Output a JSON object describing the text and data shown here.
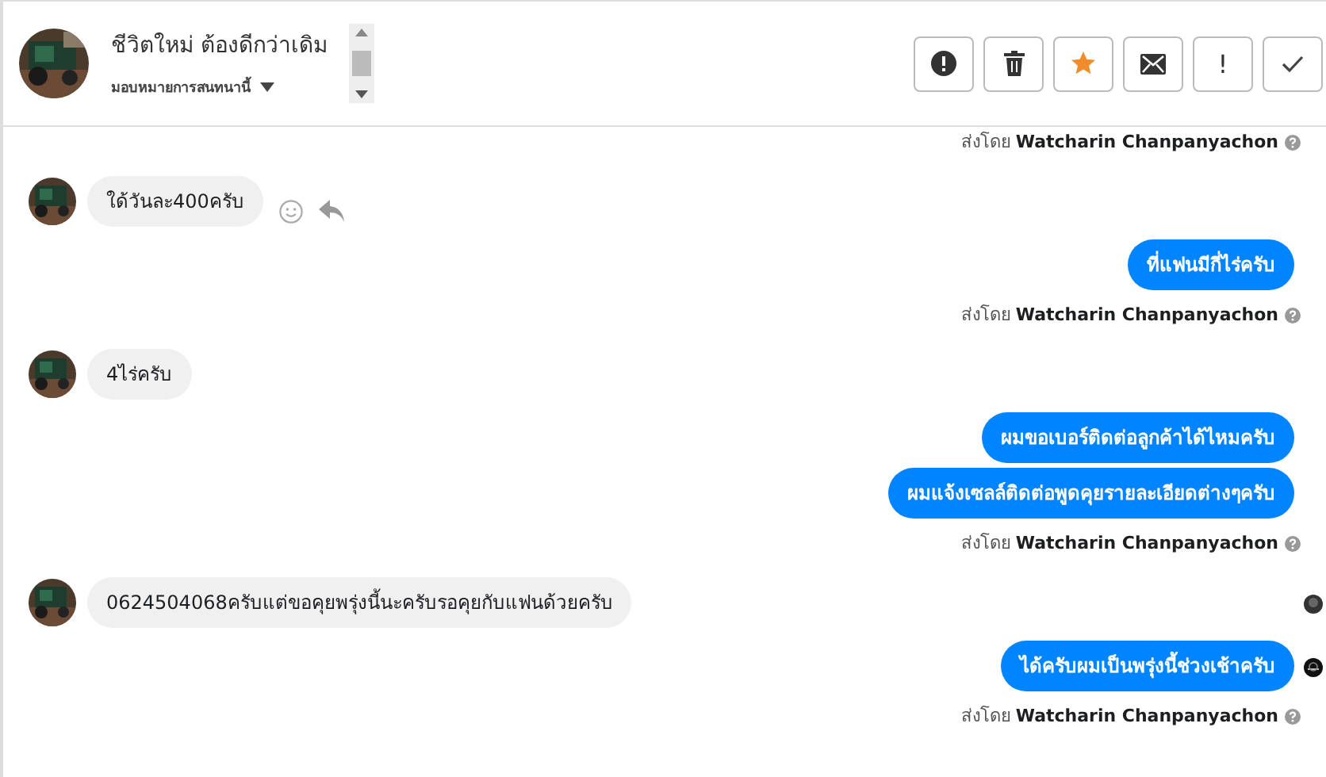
{
  "header": {
    "title": "ชีวิตใหม่ ต้องดีกว่าเดิม",
    "assign": "มอบหมายการสนทนานี้",
    "toolbar": [
      {
        "kind": "alert"
      },
      {
        "kind": "trash"
      },
      {
        "kind": "star"
      },
      {
        "kind": "mail"
      },
      {
        "kind": "bang",
        "label": "!"
      },
      {
        "kind": "check"
      }
    ]
  },
  "messages": [
    {
      "kind": "sender",
      "prefix": "ส่งโดย",
      "name": "Watcharin Chanpanyachon"
    },
    {
      "kind": "incoming",
      "text": "ใด้วันละ400ครับ",
      "actions": true,
      "read_marker": false
    },
    {
      "kind": "outgoing",
      "text": "ที่แฟนมีกี่ไร่ครับ",
      "read_marker": false
    },
    {
      "kind": "sender",
      "prefix": "ส่งโดย",
      "name": "Watcharin Chanpanyachon"
    },
    {
      "kind": "incoming",
      "text": "4ไร่ครับ",
      "actions": false,
      "read_marker": false
    },
    {
      "kind": "outgoing",
      "text": "ผมขอเบอร์ติดต่อลูกค้าได้ไหมครับ",
      "read_marker": false
    },
    {
      "kind": "outgoing",
      "text": "ผมแจ้งเซลล์ติดต่อพูดคุยรายละเอียดต่างๆครับ",
      "read_marker": false
    },
    {
      "kind": "sender",
      "prefix": "ส่งโดย",
      "name": "Watcharin Chanpanyachon"
    },
    {
      "kind": "incoming",
      "text": "0624504068ครับแต่ขอคุยพรุ่งนี้นะครับรอคุยกับแฟนด้วยครับ",
      "actions": false,
      "read_marker": true
    },
    {
      "kind": "outgoing",
      "text": "ได้ครับผมเป็นพรุ่งนี้ช่วงเช้าครับ",
      "read_marker": true
    },
    {
      "kind": "sender",
      "prefix": "ส่งโดย",
      "name": "Watcharin Chanpanyachon"
    }
  ]
}
